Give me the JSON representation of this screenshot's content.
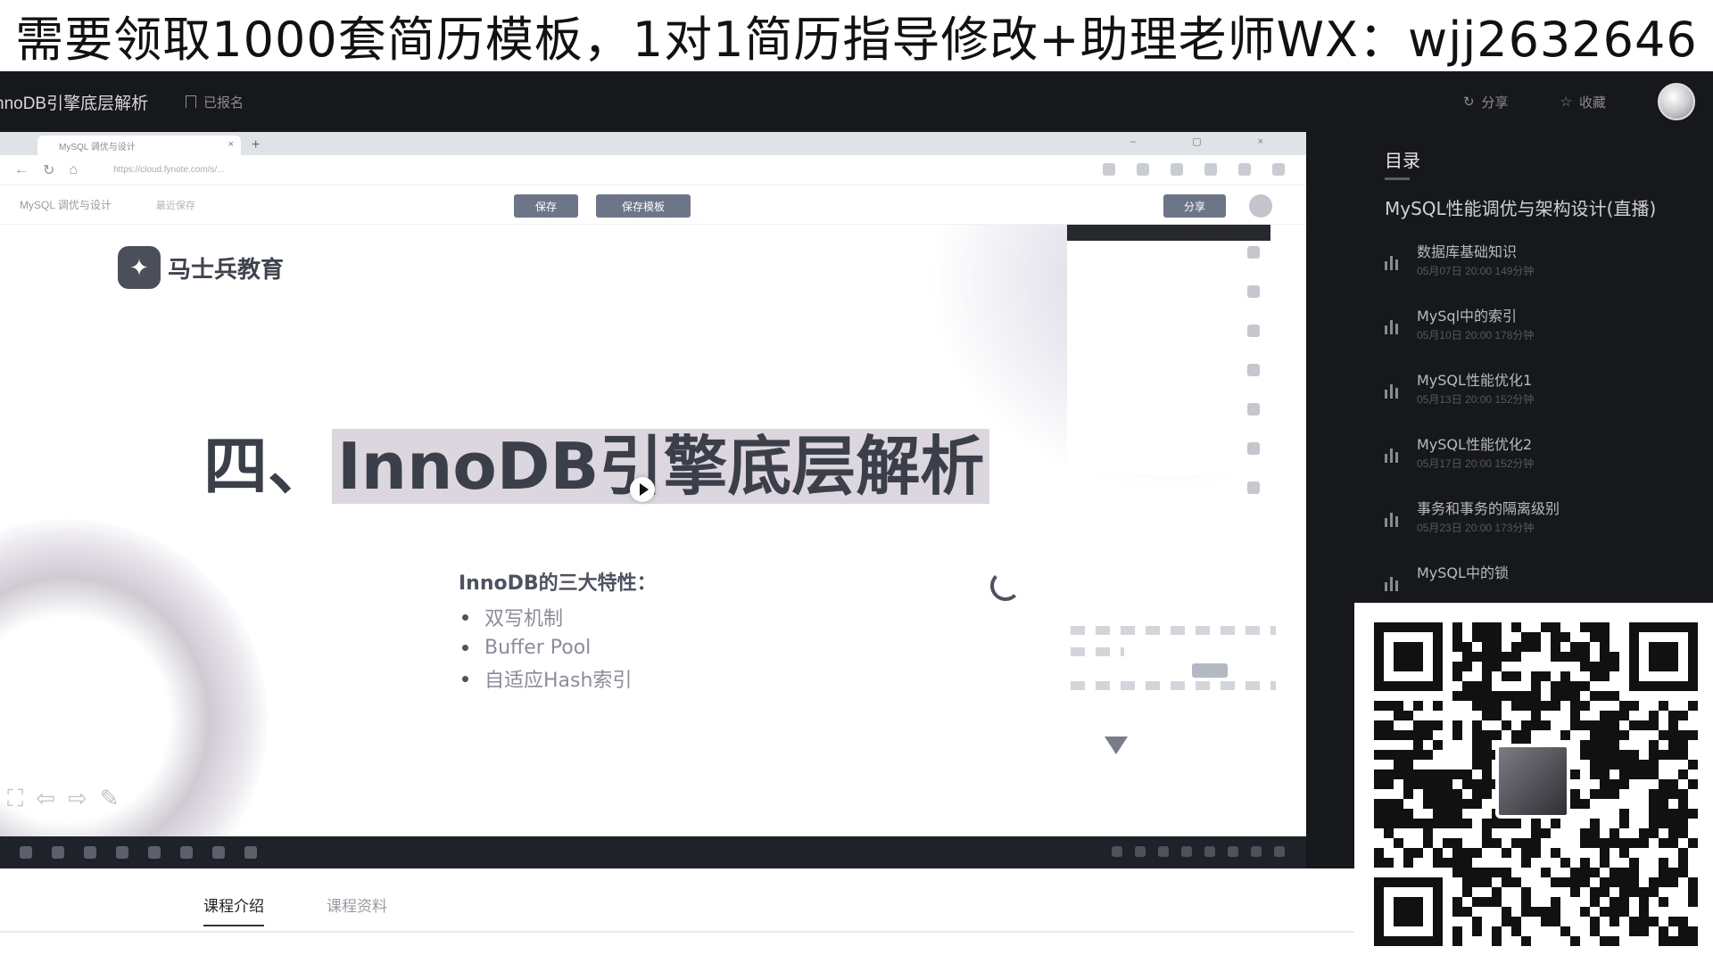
{
  "banner": {
    "text": "需要领取1000套简历模板，1对1简历指导修改+助理老师WX：wjj2632646"
  },
  "player_header": {
    "course_title": "nnoDB引擎底层解析",
    "signed_label": "已报名",
    "share_label": "分享",
    "favorite_label": "收藏"
  },
  "video": {
    "browser": {
      "tab_title": "MySQL 调优与设计",
      "url": "https://cloud.fynote.com/s/..."
    },
    "doc_toolbar": {
      "doc_title": "MySQL 调优与设计",
      "saved_text": "最近保存",
      "save_label": "保存",
      "save_template_label": "保存模板",
      "share_label": "分享"
    },
    "slide": {
      "logo_name": "马士兵教育",
      "title_prefix": "四、",
      "title_main": "InnoDB引擎底层解析",
      "features_title": "InnoDB的三大特性：",
      "features": [
        "双写机制",
        "Buffer Pool",
        "自适应Hash索引"
      ]
    }
  },
  "sidebar": {
    "toc_label": "目录",
    "course_name": "MySQL性能调优与架构设计(直播)",
    "lessons": [
      {
        "title": "数据库基础知识",
        "meta": "05月07日 20:00    149分钟"
      },
      {
        "title": "MySql中的索引",
        "meta": "05月10日 20:00    178分钟"
      },
      {
        "title": "MySQL性能优化1",
        "meta": "05月13日 20:00    152分钟"
      },
      {
        "title": "MySQL性能优化2",
        "meta": "05月17日 20:00    152分钟"
      },
      {
        "title": "事务和事务的隔离级别",
        "meta": "05月23日 20:00    173分钟"
      },
      {
        "title": "MySQL中的锁",
        "meta": ""
      }
    ]
  },
  "bottom_tabs": {
    "intro": "课程介绍",
    "materials": "课程资料"
  },
  "icons": {
    "qr": "qr-code-icon",
    "play": "play-icon"
  }
}
